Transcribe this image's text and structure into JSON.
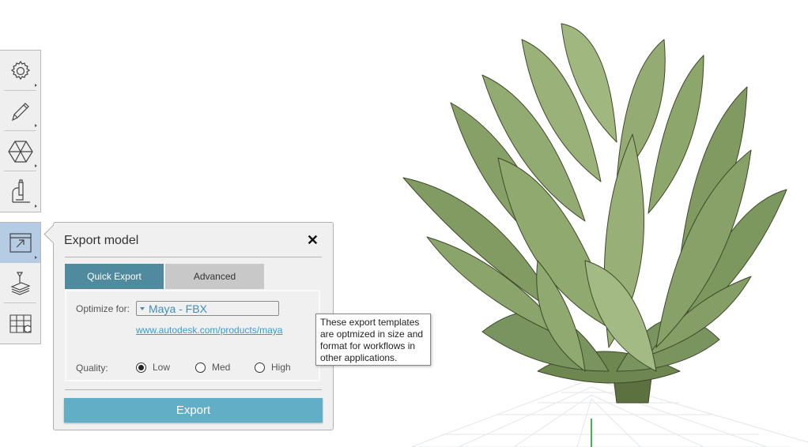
{
  "toolbar": {
    "top_tools": [
      {
        "icon": "gear-icon",
        "name": "settings"
      },
      {
        "icon": "pencil-icon",
        "name": "edit"
      },
      {
        "icon": "hexagon-icon",
        "name": "model"
      },
      {
        "icon": "microscope-icon",
        "name": "analyze"
      }
    ],
    "bottom_tools": [
      {
        "icon": "export-icon",
        "name": "export",
        "active": true
      },
      {
        "icon": "print-3d-icon",
        "name": "print"
      },
      {
        "icon": "grid-cube-icon",
        "name": "scene"
      }
    ]
  },
  "dialog": {
    "title": "Export model",
    "close_label": "✕",
    "tabs": [
      {
        "label": "Quick Export",
        "active": true
      },
      {
        "label": "Advanced",
        "active": false
      }
    ],
    "optimize_label": "Optimize for:",
    "optimize_value": "Maya - FBX",
    "link": "www.autodesk.com/products/maya",
    "quality_label": "Quality:",
    "quality_options": [
      {
        "label": "Low",
        "selected": true
      },
      {
        "label": "Med",
        "selected": false
      },
      {
        "label": "High",
        "selected": false
      }
    ],
    "export_label": "Export"
  },
  "tooltip": {
    "text": "These export templates are optmized in size and format for workflows in other applications."
  },
  "colors": {
    "accent": "#61aec6",
    "tab_active": "#4f8a9e",
    "link": "#3a9cc4",
    "active_tool": "#b6cbe4"
  }
}
